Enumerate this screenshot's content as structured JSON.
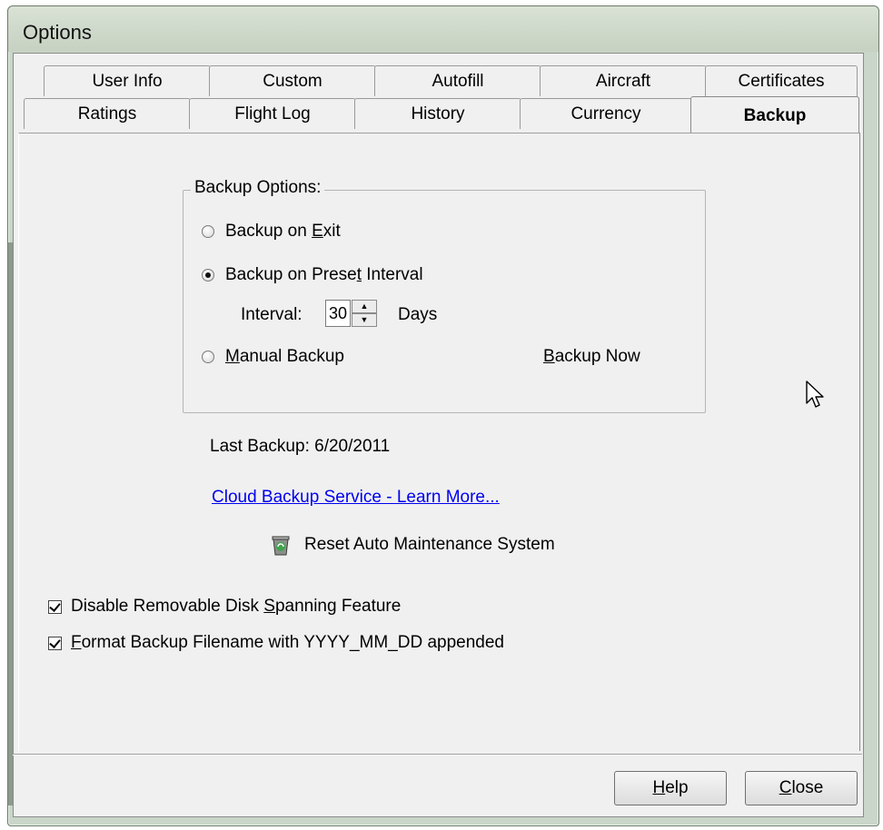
{
  "window": {
    "title": "Options"
  },
  "tabs_row1": [
    {
      "label": "User Info"
    },
    {
      "label": "Custom"
    },
    {
      "label": "Autofill"
    },
    {
      "label": "Aircraft"
    },
    {
      "label": "Certificates"
    }
  ],
  "tabs_row2": [
    {
      "label": "Ratings"
    },
    {
      "label": "Flight Log"
    },
    {
      "label": "History"
    },
    {
      "label": "Currency"
    },
    {
      "label": "Backup",
      "active": true
    }
  ],
  "backup_options": {
    "legend": "Backup Options:",
    "on_exit": {
      "pre": "Backup on ",
      "accel": "E",
      "post": "xit",
      "checked": false
    },
    "preset_interval": {
      "pre": "Backup on Prese",
      "accel": "t",
      "post": " Interval",
      "checked": true
    },
    "interval_label": "Interval:",
    "interval_value": "30",
    "interval_unit": "Days",
    "manual": {
      "pre": "",
      "accel": "M",
      "post": "anual Backup",
      "checked": false
    },
    "backup_now": {
      "accel": "B",
      "post": "ackup Now"
    }
  },
  "last_backup": "Last Backup: 6/20/2011",
  "cloud_link": "Cloud Backup Service - Learn More...",
  "reset_maintenance": "Reset Auto Maintenance System",
  "checkboxes": {
    "disable_spanning": {
      "pre": "Disable Removable Disk ",
      "accel": "S",
      "post": "panning Feature",
      "checked": true
    },
    "format_filename": {
      "pre": "",
      "accel": "F",
      "post": "ormat Backup Filename with YYYY_MM_DD appended",
      "checked": true
    }
  },
  "buttons": {
    "help": {
      "accel": "H",
      "post": "elp"
    },
    "close": {
      "accel": "C",
      "post": "lose"
    }
  },
  "icons": {
    "recycle": "recycle-bin-icon",
    "cursor": "mouse-pointer-icon"
  }
}
